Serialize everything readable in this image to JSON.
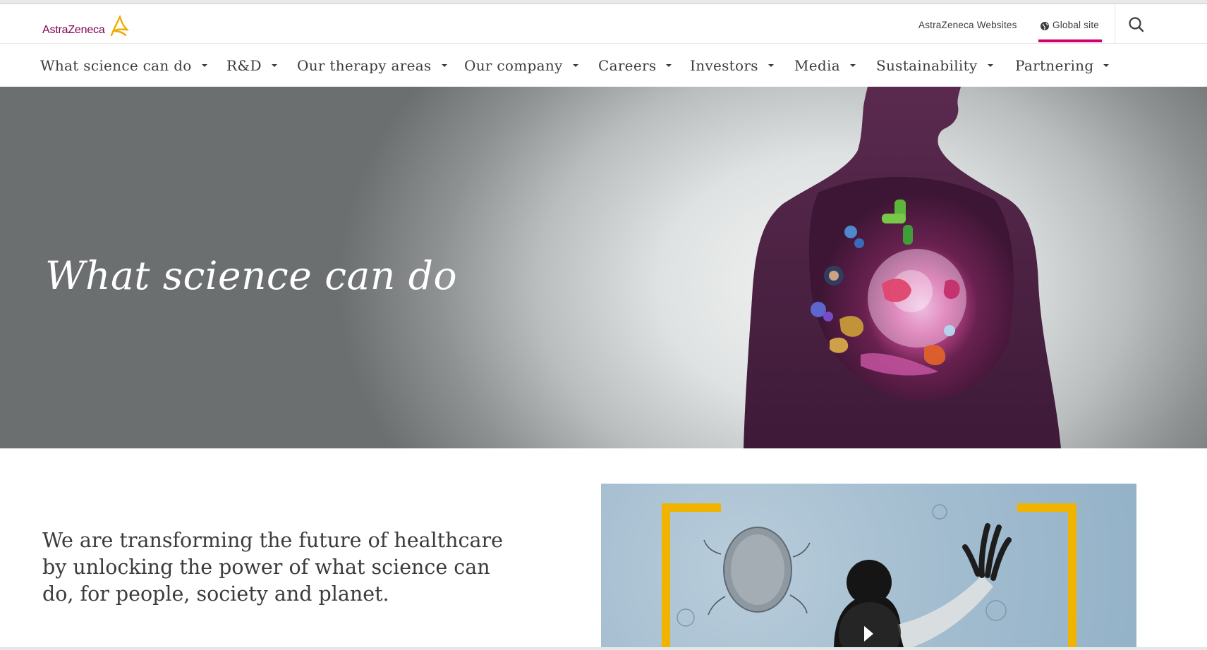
{
  "colors": {
    "brand": "#830051",
    "accent": "#d0006f",
    "logo_gold": "#f0ab00",
    "text": "#3c3c3c"
  },
  "header": {
    "logo_text": "AstraZeneca",
    "logo_icon": "astrazeneca-logo-icon",
    "websites_label": "AstraZeneca Websites",
    "global_label": "Global site",
    "globe_icon": "globe-icon",
    "search_icon": "search-icon"
  },
  "nav": {
    "items": [
      {
        "label": "What science can do"
      },
      {
        "label": "R&D"
      },
      {
        "label": "Our therapy areas"
      },
      {
        "label": "Our company"
      },
      {
        "label": "Careers"
      },
      {
        "label": "Investors"
      },
      {
        "label": "Media"
      },
      {
        "label": "Sustainability"
      },
      {
        "label": "Partnering"
      }
    ],
    "caret_icon": "caret-down-icon"
  },
  "hero": {
    "title": "What science can do"
  },
  "intro": {
    "text": "We are transforming the future of healthcare by unlocking the power of what science can do, for people, society and planet."
  },
  "video": {
    "play_icon": "play-icon"
  }
}
